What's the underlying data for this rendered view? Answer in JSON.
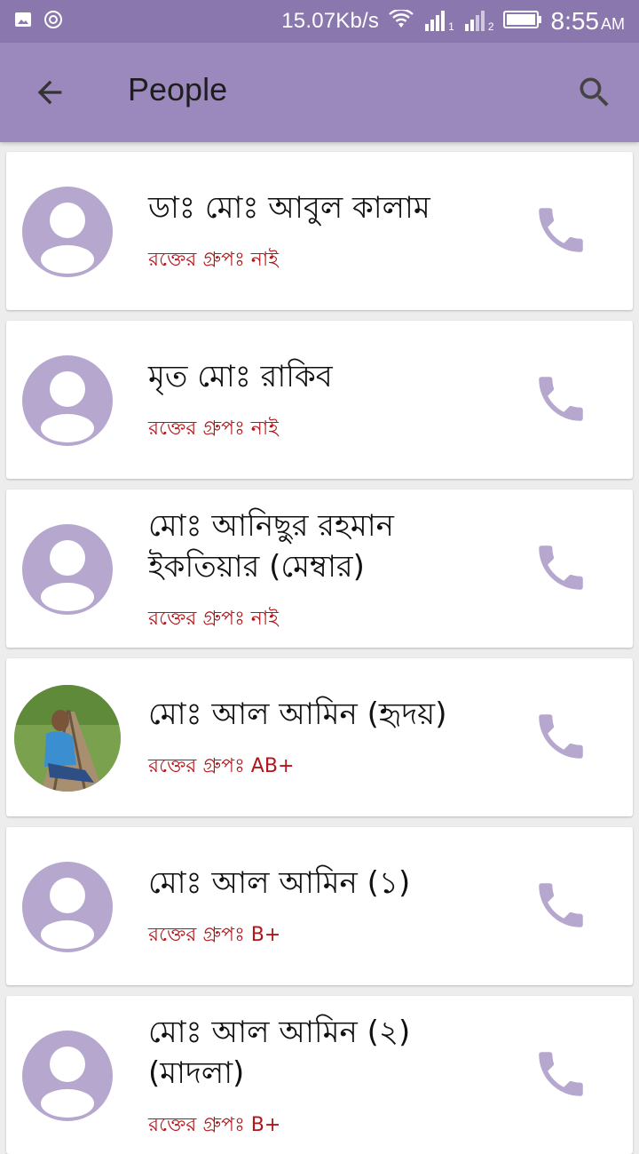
{
  "status_bar": {
    "net_speed": "15.07Kb/s",
    "time": "8:55",
    "ampm": "AM",
    "sim1": "1",
    "sim2": "2"
  },
  "app_bar": {
    "title": "People"
  },
  "colors": {
    "app_bar": "#9b88bc",
    "status_bar": "#8a77ad",
    "accent": "#b6a7cf",
    "blood_text": "#b1161a"
  },
  "contacts": [
    {
      "name": "ডাঃ মোঃ আবুল কালাম",
      "blood_group": "রক্তের গ্রুপঃ নাই"
    },
    {
      "name": "মৃত মোঃ রাকিব",
      "blood_group": "রক্তের গ্রুপঃ নাই"
    },
    {
      "name": "মোঃ আনিছুর রহমান ইকতিয়ার (মেম্বার)",
      "blood_group": "রক্তের গ্রুপঃ নাই"
    },
    {
      "name": "মোঃ আল আমিন (হৃদয়)",
      "blood_group": "রক্তের গ্রুপঃ AB+"
    },
    {
      "name": "মোঃ আল আমিন (১)",
      "blood_group": "রক্তের গ্রুপঃ B+"
    },
    {
      "name": "মোঃ আল আমিন (২) (মাদলা)",
      "blood_group": "রক্তের গ্রুপঃ B+"
    }
  ]
}
